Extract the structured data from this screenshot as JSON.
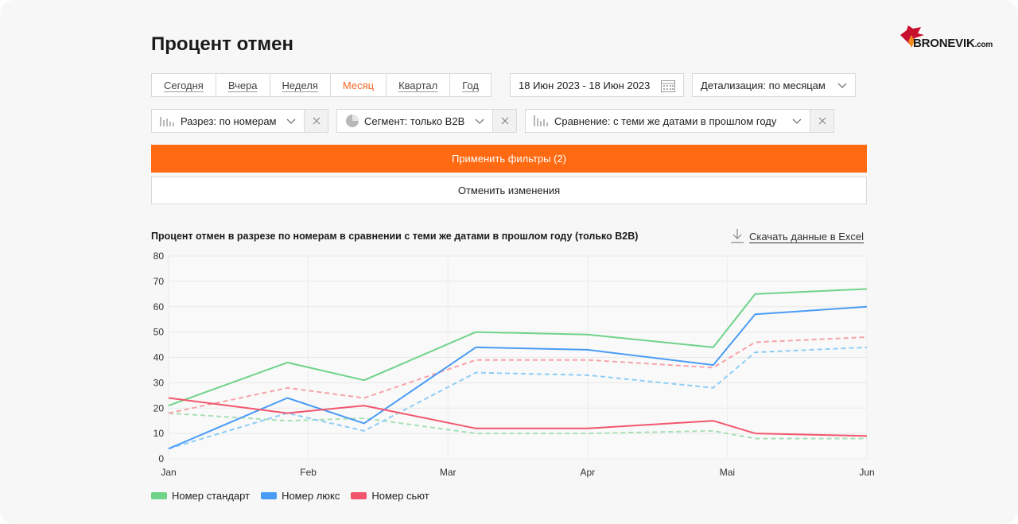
{
  "header": {
    "title": "Процент отмен"
  },
  "logo": {
    "text": "BRONEVIK",
    "domain": ".com"
  },
  "periods": [
    {
      "label": "Сегодня",
      "active": false
    },
    {
      "label": "Вчера",
      "active": false
    },
    {
      "label": "Неделя",
      "active": false
    },
    {
      "label": "Месяц",
      "active": true
    },
    {
      "label": "Квартал",
      "active": false
    },
    {
      "label": "Год",
      "active": false
    }
  ],
  "date_range": {
    "value": "18 Июн 2023 - 18 Июн 2023",
    "icon": "calendar-icon"
  },
  "detail": {
    "value": "Детализация: по месяцам",
    "icon": "chevron-down-icon"
  },
  "filters": {
    "cut": {
      "label": "Разрез: по номерам",
      "icon": "bar-chart-icon"
    },
    "segment": {
      "label": "Сегмент: только B2B",
      "icon": "pie-chart-icon"
    },
    "compare": {
      "label": "Сравнение: с теми же датами в прошлом году",
      "icon": "bar-chart-icon"
    }
  },
  "actions": {
    "apply": "Применить фильтры (2)",
    "cancel": "Отменить изменения"
  },
  "chart_header": {
    "title": "Процент отмен в разрезе по номерам в сравнении с теми же датами в прошлом году (только B2B)",
    "download": "Скачать данные в Excel",
    "download_icon": "download-icon"
  },
  "chart_data": {
    "type": "line",
    "x": [
      "Jan",
      "Feb",
      "Mar",
      "Apr",
      "Mai",
      "Jun"
    ],
    "y_ticks": [
      0,
      10,
      20,
      30,
      40,
      50,
      60,
      70,
      80
    ],
    "ylim": [
      0,
      80
    ],
    "grid": true,
    "legend_position": "bottom-left",
    "series": [
      {
        "name": "Номер стандарт",
        "color": "#6fd38a",
        "style": "solid",
        "points": [
          [
            0,
            21
          ],
          [
            0.85,
            38
          ],
          [
            1.4,
            31
          ],
          [
            2.2,
            50
          ],
          [
            3.0,
            49
          ],
          [
            3.9,
            44
          ],
          [
            4.2,
            65
          ],
          [
            5.0,
            67
          ]
        ]
      },
      {
        "name": "Номер люкс",
        "color": "#4a9cf5",
        "style": "solid",
        "points": [
          [
            0,
            4
          ],
          [
            0.85,
            24
          ],
          [
            1.4,
            14
          ],
          [
            2.2,
            44
          ],
          [
            3.0,
            43
          ],
          [
            3.9,
            37
          ],
          [
            4.2,
            57
          ],
          [
            5.0,
            60
          ]
        ]
      },
      {
        "name": "Номер сьют",
        "color": "#f2566e",
        "style": "solid",
        "points": [
          [
            0,
            24
          ],
          [
            0.85,
            18
          ],
          [
            1.4,
            21
          ],
          [
            2.2,
            12
          ],
          [
            3.0,
            12
          ],
          [
            3.9,
            15
          ],
          [
            4.2,
            10
          ],
          [
            5.0,
            9
          ]
        ]
      },
      {
        "color": "#a8dfb6",
        "style": "dashed",
        "points": [
          [
            0,
            18
          ],
          [
            0.85,
            15
          ],
          [
            1.4,
            16
          ],
          [
            2.2,
            10
          ],
          [
            3.0,
            10
          ],
          [
            3.9,
            11
          ],
          [
            4.2,
            8
          ],
          [
            5.0,
            8
          ]
        ]
      },
      {
        "color": "#8fcdf6",
        "style": "dashed",
        "points": [
          [
            0,
            4
          ],
          [
            0.85,
            18
          ],
          [
            1.4,
            11
          ],
          [
            2.2,
            34
          ],
          [
            3.0,
            33
          ],
          [
            3.9,
            28
          ],
          [
            4.2,
            42
          ],
          [
            5.0,
            44
          ]
        ]
      },
      {
        "color": "#f7a3a8",
        "style": "dashed",
        "points": [
          [
            0,
            18
          ],
          [
            0.85,
            28
          ],
          [
            1.4,
            24
          ],
          [
            2.2,
            39
          ],
          [
            3.0,
            39
          ],
          [
            3.9,
            36
          ],
          [
            4.2,
            46
          ],
          [
            5.0,
            48
          ]
        ]
      }
    ]
  }
}
